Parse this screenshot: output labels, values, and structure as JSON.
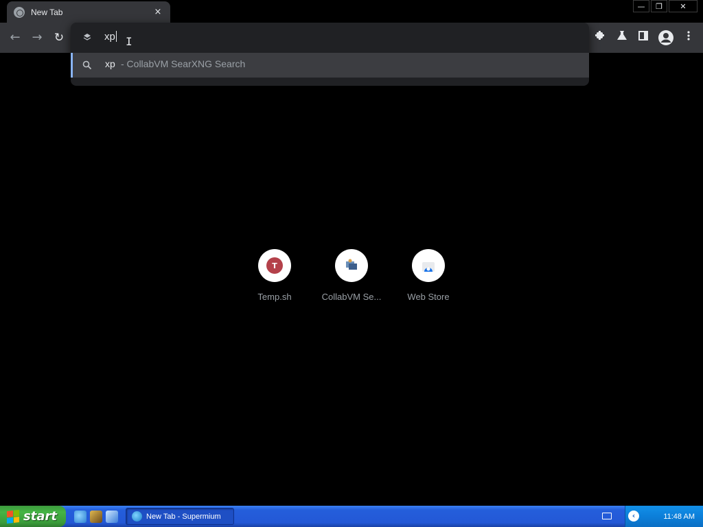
{
  "browser": {
    "tab": {
      "title": "New Tab",
      "favicon": "globe-icon",
      "close": "×"
    },
    "window_controls": {
      "minimize": "—",
      "restore": "❐",
      "close": "✕"
    },
    "nav": {
      "back": "←",
      "forward": "→",
      "reload": "↻"
    },
    "omnibox": {
      "value": "xp",
      "suggestion": {
        "query": "xp",
        "description": " - CollabVM SearXNG Search",
        "icon": "search-icon"
      }
    },
    "toolbar_right": [
      "extensions-icon",
      "labs-icon",
      "side-panel-icon",
      "profile-icon",
      "menu-icon"
    ]
  },
  "new_tab": {
    "shortcuts": [
      {
        "label": "Temp.sh",
        "letter": "T",
        "color": "#c0434b"
      },
      {
        "label": "CollabVM Se...",
        "letter": "",
        "color": "#5a7fa6"
      },
      {
        "label": "Web Store",
        "letter": "",
        "color": "#1a73e8"
      }
    ]
  },
  "taskbar": {
    "start_label": "start",
    "task_title": "New Tab - Supermium",
    "clock": "11:48 AM",
    "accent": "#245edb"
  }
}
